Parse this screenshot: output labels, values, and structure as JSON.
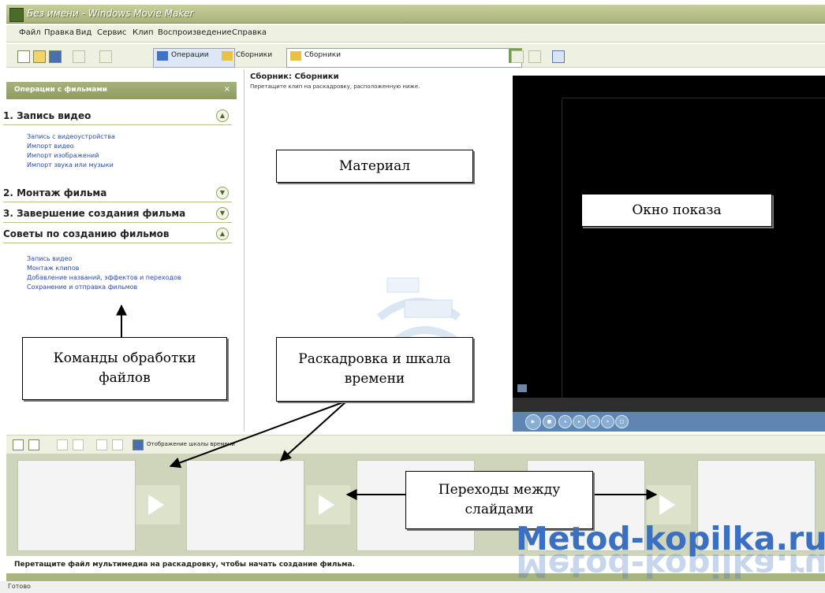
{
  "window": {
    "title": "Без имени - Windows Movie Maker",
    "menu": [
      "Файл",
      "Правка",
      "Вид",
      "Сервис",
      "Клип",
      "Воспроизведение",
      "Справка"
    ]
  },
  "toolbar": {
    "tasks_button": "Операции",
    "collections_button": "Сборники",
    "collection_select": "Сборники"
  },
  "task_pane": {
    "header": "Операции с фильмами",
    "sections": [
      {
        "title": "1. Запись видео",
        "links": [
          "Запись с видеоустройства",
          "Импорт видео",
          "Импорт изображений",
          "Импорт звука или музыки"
        ]
      },
      {
        "title": "2. Монтаж фильма",
        "links": []
      },
      {
        "title": "3. Завершение создания фильма",
        "links": []
      },
      {
        "title": "Советы по созданию фильмов",
        "links": [
          "Запись видео",
          "Монтаж клипов",
          "Добавление названий, эффектов и переходов",
          "Сохранение и отправка фильмов"
        ]
      }
    ]
  },
  "collection_pane": {
    "title": "Сборник: Сборники",
    "subtitle": "Перетащите клип на раскадровку, расположенную ниже."
  },
  "storyboard": {
    "toolbar_label": "Отображение шкалы времени",
    "hint": "Перетащите файл мультимедиа на раскадровку, чтобы начать создание фильма."
  },
  "status": {
    "text": "Готово"
  },
  "annotations": {
    "material": "Материал",
    "preview_window": "Окно показа",
    "commands": [
      "Команды обработки",
      "файлов"
    ],
    "storyboard_timeline": [
      "Раскадровка и шкала",
      "времени"
    ],
    "transitions": [
      "Переходы между",
      "слайдами"
    ]
  },
  "watermark": "Metod-kopilka.ru",
  "colors": {
    "accent_green": "#a7b37c",
    "preview_black": "#000000",
    "watermark_blue": "#3b6fc1"
  }
}
